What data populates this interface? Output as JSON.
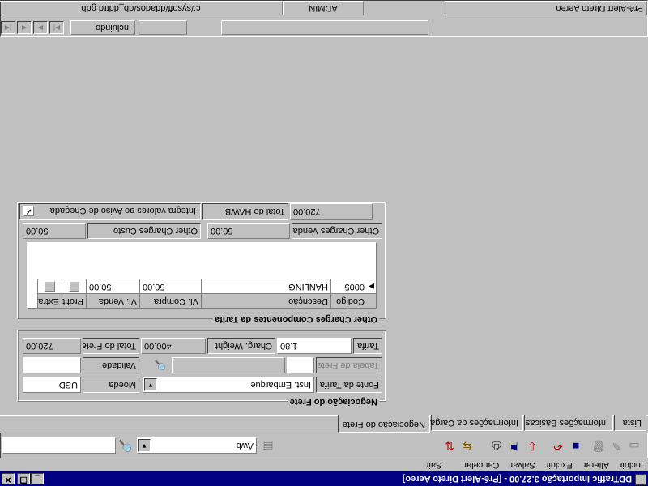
{
  "window": {
    "title": "DDTraffic Importação 3.27.00 - [Pré-Alert Direto Aereo]",
    "controls": {
      "minimize": "_",
      "restore": "❐",
      "close": "✕"
    }
  },
  "menu": {
    "items": [
      {
        "label": "Incluir",
        "enabled": false
      },
      {
        "label": "Alterar",
        "enabled": false
      },
      {
        "label": "Excluir",
        "enabled": false
      },
      {
        "label": "Salvar",
        "enabled": true
      },
      {
        "label": "Cancelar",
        "enabled": true
      },
      {
        "label": "Sair",
        "enabled": false
      }
    ]
  },
  "toolbar": {
    "search_combo_value": "Awb",
    "search_input_value": ""
  },
  "tabs": [
    {
      "label": "Lista",
      "active": false
    },
    {
      "label": "Informações Básicas",
      "active": false
    },
    {
      "label": "Informações da Carga",
      "active": false
    },
    {
      "label": "Negociação do Frete",
      "active": true
    }
  ],
  "negociacao": {
    "group_title": "Negociação do Frete",
    "fonte_label": "Fonte da Tarifa",
    "fonte_value": "Inst. Embarque",
    "moeda_label": "Moeda",
    "moeda_value": "USD",
    "tabela_label": "Tabela de Frete",
    "tabela_code": "",
    "tabela_desc": "",
    "validade_label": "Validade",
    "validade_value": "",
    "tarifa_label": "Tarifa",
    "tarifa_value": "1.80",
    "chargw_label": "Charg. Weight",
    "chargw_value": "400.00",
    "total_frete_label": "Total do Frete",
    "total_frete_value": "720.00"
  },
  "other_charges": {
    "group_title": "Other Charges Componentes da Tarifa",
    "columns": [
      "Codigo",
      "Descrição",
      "Vl. Compra",
      "Vl. Venda",
      "Profit",
      "Extra"
    ],
    "rows": [
      {
        "codigo": "0005",
        "descricao": "HANLING",
        "vl_compra": "50.00",
        "vl_venda": "50.00",
        "profit": false,
        "extra": false
      }
    ],
    "custo_label": "Other Charges Custo",
    "custo_value": "50.00",
    "venda_label": "Other Charges Venda",
    "venda_value": "50.00",
    "integra_label": "Integra valores ao Aviso de Chegada",
    "integra_checked": true,
    "total_hawb_label": "Total do HAWB",
    "total_hawb_value": "720.00"
  },
  "statusbar": {
    "nav_first": "|◀",
    "nav_prev": "◀",
    "nav_next": "▶",
    "nav_last": "▶|",
    "mode": "Incluindo",
    "db_path": "c:/sysoff/ddados/db_ddtrd.gdb",
    "user": "ADMIN",
    "screen": "Pré-Alert Direto Aereo"
  }
}
